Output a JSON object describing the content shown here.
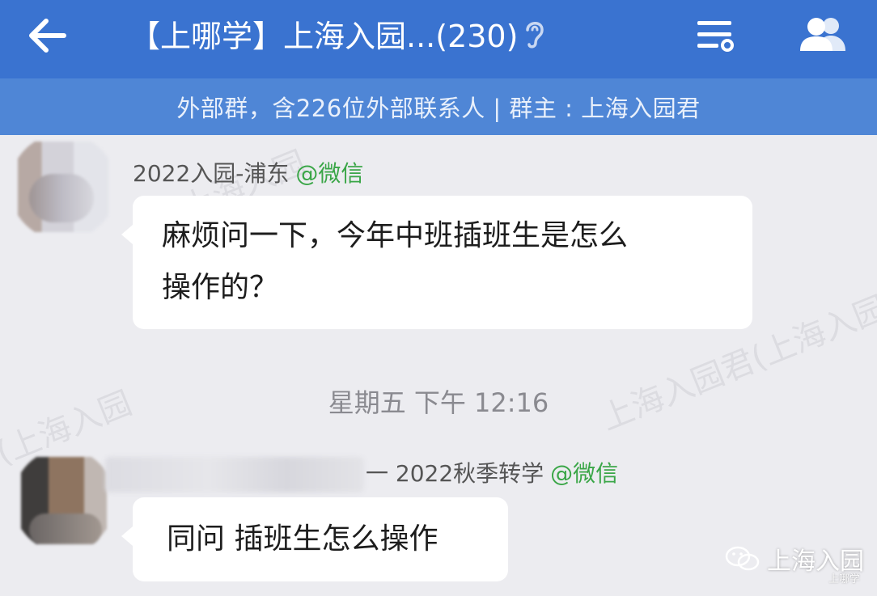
{
  "header": {
    "title": "【上哪学】上海入园...(230)",
    "back_icon": "arrow-left-icon",
    "menu_icon": "settings-lines-icon",
    "members_icon": "group-members-icon"
  },
  "info_bar": {
    "text": "外部群，含226位外部联系人 | 群主 : 上海入园君"
  },
  "messages": [
    {
      "sender": "2022入园-浦东",
      "source": "@微信",
      "text_line1": "麻烦问一下，今年中班插班生是怎么",
      "text_line2": "操作的？"
    },
    {
      "sender": "一 2022秋季转学",
      "source": "@微信",
      "text_line1": "同问 插班生怎么操作"
    }
  ],
  "timestamp": "星期五  下午 12:16",
  "watermark": {
    "text1": "上海入园君(上海入园",
    "text2": "(上海入园",
    "text3": "上海入园"
  },
  "brand": {
    "name": "上海入园",
    "sub": "上哪学"
  },
  "colors": {
    "header_bg": "#3a73d0",
    "infobar_bg": "#4f86d6",
    "chat_bg": "#ececf0",
    "source_green": "#3aa647"
  }
}
